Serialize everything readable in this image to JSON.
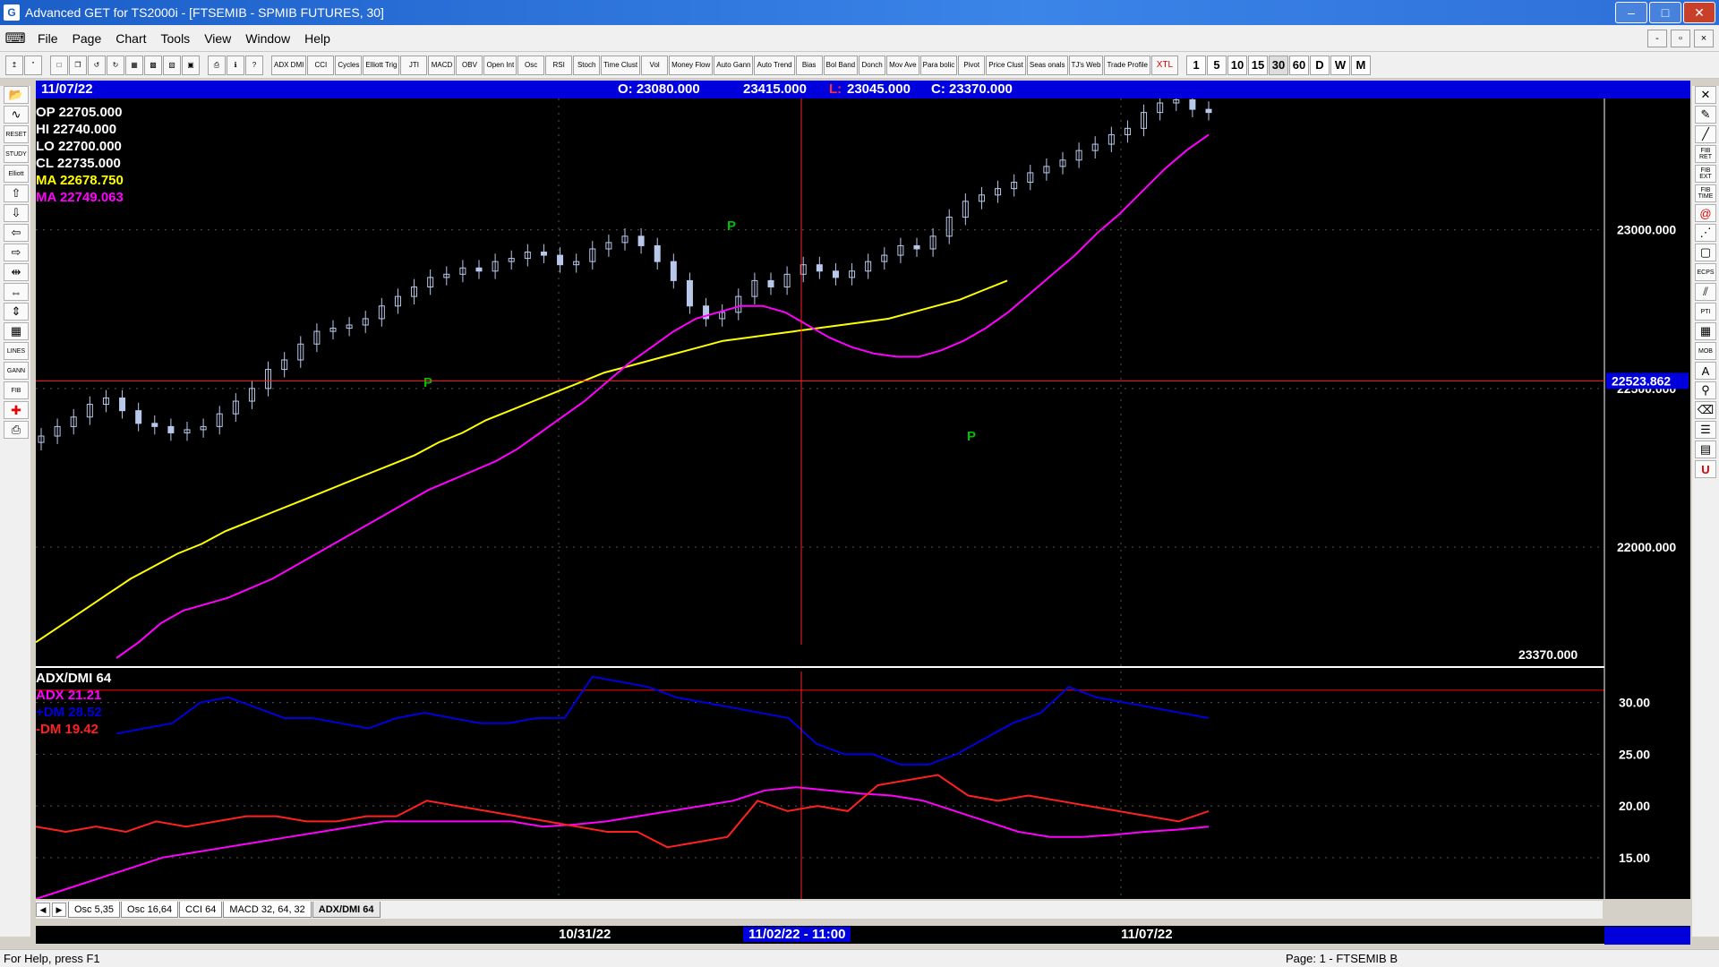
{
  "window": {
    "title": "Advanced GET for TS2000i - [FTSEMIB - SPMIB FUTURES, 30]",
    "app_icon": "app-icon",
    "buttons": [
      "minimize",
      "maximize",
      "close"
    ]
  },
  "menu": {
    "items": [
      "File",
      "Page",
      "Chart",
      "Tools",
      "View",
      "Window",
      "Help"
    ],
    "mdi_buttons": [
      "-",
      "▫",
      "×"
    ]
  },
  "toolbar": {
    "indicators": [
      "ADX DMI",
      "CCI",
      "Cycles",
      "Elliott Trig",
      "JTI",
      "MACD",
      "OBV",
      "Open Int",
      "Osc",
      "RSI",
      "Stoch",
      "Time Clust",
      "Vol",
      "Money Flow",
      "Auto Gann",
      "Auto Trend",
      "Bias",
      "Bol Band",
      "Donch",
      "Mov Ave",
      "Para bolic",
      "Pivot",
      "Price Clust",
      "Seas onals",
      "TJ's Web",
      "Trade Profile",
      "XTL"
    ],
    "periods": [
      "1",
      "5",
      "10",
      "15",
      "30",
      "60",
      "D",
      "W",
      "M"
    ],
    "active_period": "30"
  },
  "left_tools": [
    "open-folder-icon",
    "pattern-icon",
    "reset-icon",
    "study-icon",
    "elliott-icon",
    "arrow-up-icon",
    "arrow-down-icon",
    "arrow-left-icon",
    "arrow-right-icon",
    "compress-icon",
    "expand-icon",
    "resize-icon",
    "grid-icon",
    "lines-icon",
    "gann-icon",
    "fib-icon",
    "crosshair-icon",
    "print-icon"
  ],
  "left_tool_labels": {
    "reset": "RESET",
    "study": "STUDY",
    "elliott": "Elliott",
    "lines": "LINES",
    "gann": "GANN",
    "fib": "FIB"
  },
  "right_tools": [
    "cursor-icon",
    "pencil-icon",
    "line-icon",
    "fib-ret-icon",
    "fib-ext-icon",
    "fib-time-icon",
    "spiral-icon",
    "fan-icon",
    "box-icon",
    "ecps-icon",
    "channel-icon",
    "pti-icon",
    "grid-icon",
    "mob-icon",
    "text-icon",
    "zoom-icon",
    "eraser-icon",
    "layers-icon",
    "table-icon",
    "undo-icon"
  ],
  "right_tool_labels": {
    "fib_ret": "FIB RET",
    "fib_ext": "FIB EXT",
    "fib_time": "FIB TIME",
    "ecps": "ECPS",
    "pti": "PTI",
    "mob": "MOB"
  },
  "chart_header": {
    "date": "11/07/22",
    "open_label": "O: 23080.000",
    "high_value": "23415.000",
    "low_label": "L:",
    "low_value": "23045.000",
    "close_label": "C: 23370.000"
  },
  "ohlc_legend": {
    "op": "OP  22705.000",
    "hi": "HI   22740.000",
    "lo": "LO  22700.000",
    "cl": "CL  22735.000",
    "ma1": "MA  22678.750",
    "ma2": "MA  22749.063"
  },
  "price_axis": {
    "labels": [
      "23000.000",
      "22500.000",
      "22000.000"
    ],
    "current_price_tag": "22523.862",
    "last_close": "23370.000"
  },
  "indicator_panel": {
    "title": "ADX/DMI 64",
    "adx": "ADX 21.21",
    "plus_dm": "+DM 28.52",
    "minus_dm": "-DM  19.42",
    "axis_labels": [
      "30.00",
      "25.00",
      "20.00",
      "15.00"
    ]
  },
  "colors": {
    "candle": "#b8c8ea",
    "ma_fast": "#ffff00",
    "ma_slow": "#ff00ff",
    "adx": "#ff00ff",
    "plus_dm": "#0000dd",
    "minus_dm": "#ff2020",
    "pivot": "#00c000",
    "crosshair": "#ff2020"
  },
  "pivot_marker": "P",
  "tabs": [
    "Osc 5,35",
    "Osc 16,64",
    "CCI 64",
    "MACD 32, 64, 32",
    "ADX/DMI 64"
  ],
  "active_tab": "ADX/DMI 64",
  "date_axis": {
    "labels": [
      "10/31/22",
      "11/02/22 - 11:00",
      "11/07/22"
    ]
  },
  "status": {
    "help": "For Help, press F1",
    "page": "Page: 1 - FTSEMIB B"
  },
  "chart_data": {
    "type": "line",
    "price_range": [
      21650,
      23400
    ],
    "indicator_range": [
      11,
      33
    ],
    "price_series": [
      22350,
      22380,
      22410,
      22450,
      22470,
      22430,
      22390,
      22380,
      22360,
      22370,
      22380,
      22420,
      22460,
      22500,
      22560,
      22590,
      22640,
      22680,
      22690,
      22700,
      22720,
      22760,
      22790,
      22820,
      22850,
      22860,
      22880,
      22870,
      22900,
      22910,
      22930,
      22920,
      22890,
      22900,
      22940,
      22960,
      22980,
      22950,
      22900,
      22840,
      22760,
      22720,
      22740,
      22790,
      22840,
      22820,
      22860,
      22890,
      22870,
      22850,
      22870,
      22900,
      22920,
      22950,
      22940,
      22980,
      23040,
      23090,
      23110,
      23130,
      23150,
      23180,
      23200,
      23220,
      23250,
      23270,
      23300,
      23320,
      23370,
      23400,
      23410,
      23380,
      23370
    ],
    "ma_fast": [
      21700,
      21750,
      21800,
      21850,
      21900,
      21940,
      21980,
      22010,
      22050,
      22080,
      22110,
      22140,
      22170,
      22200,
      22230,
      22260,
      22290,
      22330,
      22360,
      22400,
      22430,
      22460,
      22490,
      22520,
      22550,
      22570,
      22590,
      22610,
      22630,
      22650,
      22660,
      22670,
      22680,
      22690,
      22700,
      22710,
      22720,
      22740,
      22760,
      22780,
      22810,
      22840
    ],
    "ma_slow": [
      21650,
      21700,
      21760,
      21800,
      21820,
      21840,
      21870,
      21900,
      21940,
      21980,
      22020,
      22060,
      22100,
      22140,
      22180,
      22210,
      22240,
      22270,
      22310,
      22360,
      22410,
      22460,
      22520,
      22580,
      22630,
      22680,
      22720,
      22740,
      22760,
      22760,
      22740,
      22700,
      22660,
      22630,
      22610,
      22600,
      22600,
      22620,
      22650,
      22690,
      22740,
      22800,
      22860,
      22920,
      22990,
      23050,
      23120,
      23190,
      23250,
      23300
    ],
    "adx": [
      11,
      12,
      13,
      14,
      15,
      15.5,
      16,
      16.5,
      17,
      17.5,
      18,
      18.5,
      18.5,
      18.5,
      18.5,
      18.5,
      18,
      18.2,
      18.5,
      19,
      19.5,
      20,
      20.5,
      21.5,
      21.8,
      21.5,
      21.2,
      21,
      20.5,
      19.5,
      18.5,
      17.5,
      17,
      17,
      17.2,
      17.5,
      17.7,
      18
    ],
    "plus_dm": [
      27,
      27.5,
      28,
      30,
      30.5,
      29.5,
      28.5,
      28.5,
      28,
      27.5,
      28.5,
      29,
      28.5,
      28,
      28,
      28.5,
      28.5,
      32.5,
      32,
      31.5,
      30.5,
      30,
      29.5,
      29,
      28.5,
      26,
      25,
      25,
      24,
      24,
      25,
      26.5,
      28,
      29,
      31.5,
      30.5,
      30,
      29.5,
      29,
      28.5
    ],
    "minus_dm": [
      18,
      17.5,
      18,
      17.5,
      18.5,
      18,
      18.5,
      19,
      19,
      18.5,
      18.5,
      19,
      19,
      20.5,
      20,
      19.5,
      19,
      18.5,
      18,
      17.5,
      17.5,
      16,
      16.5,
      17,
      20.5,
      19.5,
      20,
      19.5,
      22,
      22.5,
      23,
      21,
      20.5,
      21,
      20.5,
      20,
      19.5,
      19,
      18.5,
      19.5
    ]
  }
}
